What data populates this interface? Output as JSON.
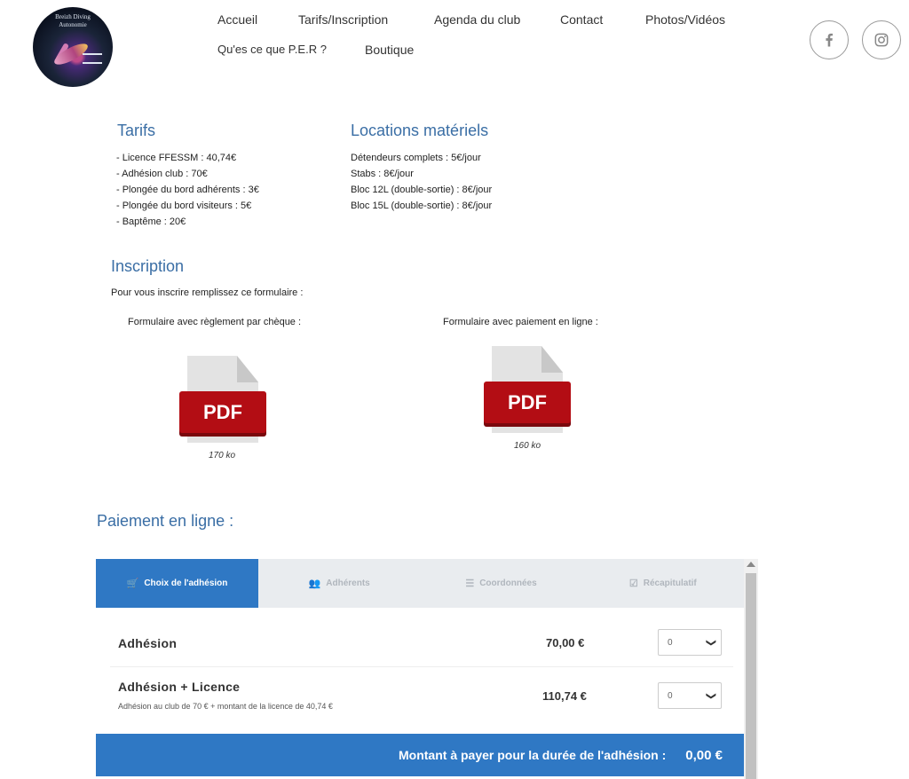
{
  "logo": {
    "text_line1": "Breizh Diving",
    "text_line2": "Autonomie"
  },
  "nav": {
    "items": [
      "Accueil",
      "Tarifs/Inscription",
      "Agenda du club",
      "Contact",
      "Photos/Vidéos",
      "Qu'es ce que P.E.R ?",
      "Boutique"
    ]
  },
  "social": {
    "facebook_icon": "facebook-icon",
    "instagram_icon": "instagram-icon"
  },
  "tarifs": {
    "title": "Tarifs",
    "items": [
      "- Licence FFESSM : 40,74€",
      "- Adhésion club : 70€",
      "- Plongée du bord adhérents : 3€",
      "- Plongée du bord visiteurs : 5€",
      "- Baptême : 20€"
    ]
  },
  "locations": {
    "title": "Locations matériels",
    "items": [
      "Détendeurs complets : 5€/jour",
      "Stabs : 8€/jour",
      "Bloc 12L (double-sortie) : 8€/jour",
      "Bloc 15L (double-sortie) : 8€/jour"
    ]
  },
  "inscription": {
    "title": "Inscription",
    "intro": "Pour vous inscrire remplissez ce formulaire :",
    "form_cheque": {
      "label": "Formulaire avec règlement par chèque :",
      "icon_text": "PDF",
      "size": "170 ko"
    },
    "form_online": {
      "label": "Formulaire avec paiement en ligne :",
      "icon_text": "PDF",
      "size": "160 ko"
    }
  },
  "payment": {
    "title": "Paiement en ligne :",
    "tabs": [
      {
        "label": "Choix de l'adhésion",
        "icon": "cart-icon",
        "glyph": "🛒"
      },
      {
        "label": "Adhérents",
        "icon": "users-icon",
        "glyph": "👥"
      },
      {
        "label": "Coordonnées",
        "icon": "list-icon",
        "glyph": "☰"
      },
      {
        "label": "Récapitulatif",
        "icon": "check-square-icon",
        "glyph": "☑"
      }
    ],
    "rows": [
      {
        "name": "Adhésion",
        "description": "",
        "price": "70,00 €",
        "qty": "0"
      },
      {
        "name": "Adhésion + Licence",
        "description": "Adhésion au club de 70 € + montant de la licence de 40,74 €",
        "price": "110,74 €",
        "qty": "0"
      }
    ],
    "total_label": "Montant à payer pour la durée de l'adhésion :",
    "total_amount": "0,00 €"
  },
  "colors": {
    "accent": "#2f78c4",
    "heading": "#3a6ea5",
    "pdf_red": "#b30d14",
    "tab_bg": "#e9ecef"
  }
}
